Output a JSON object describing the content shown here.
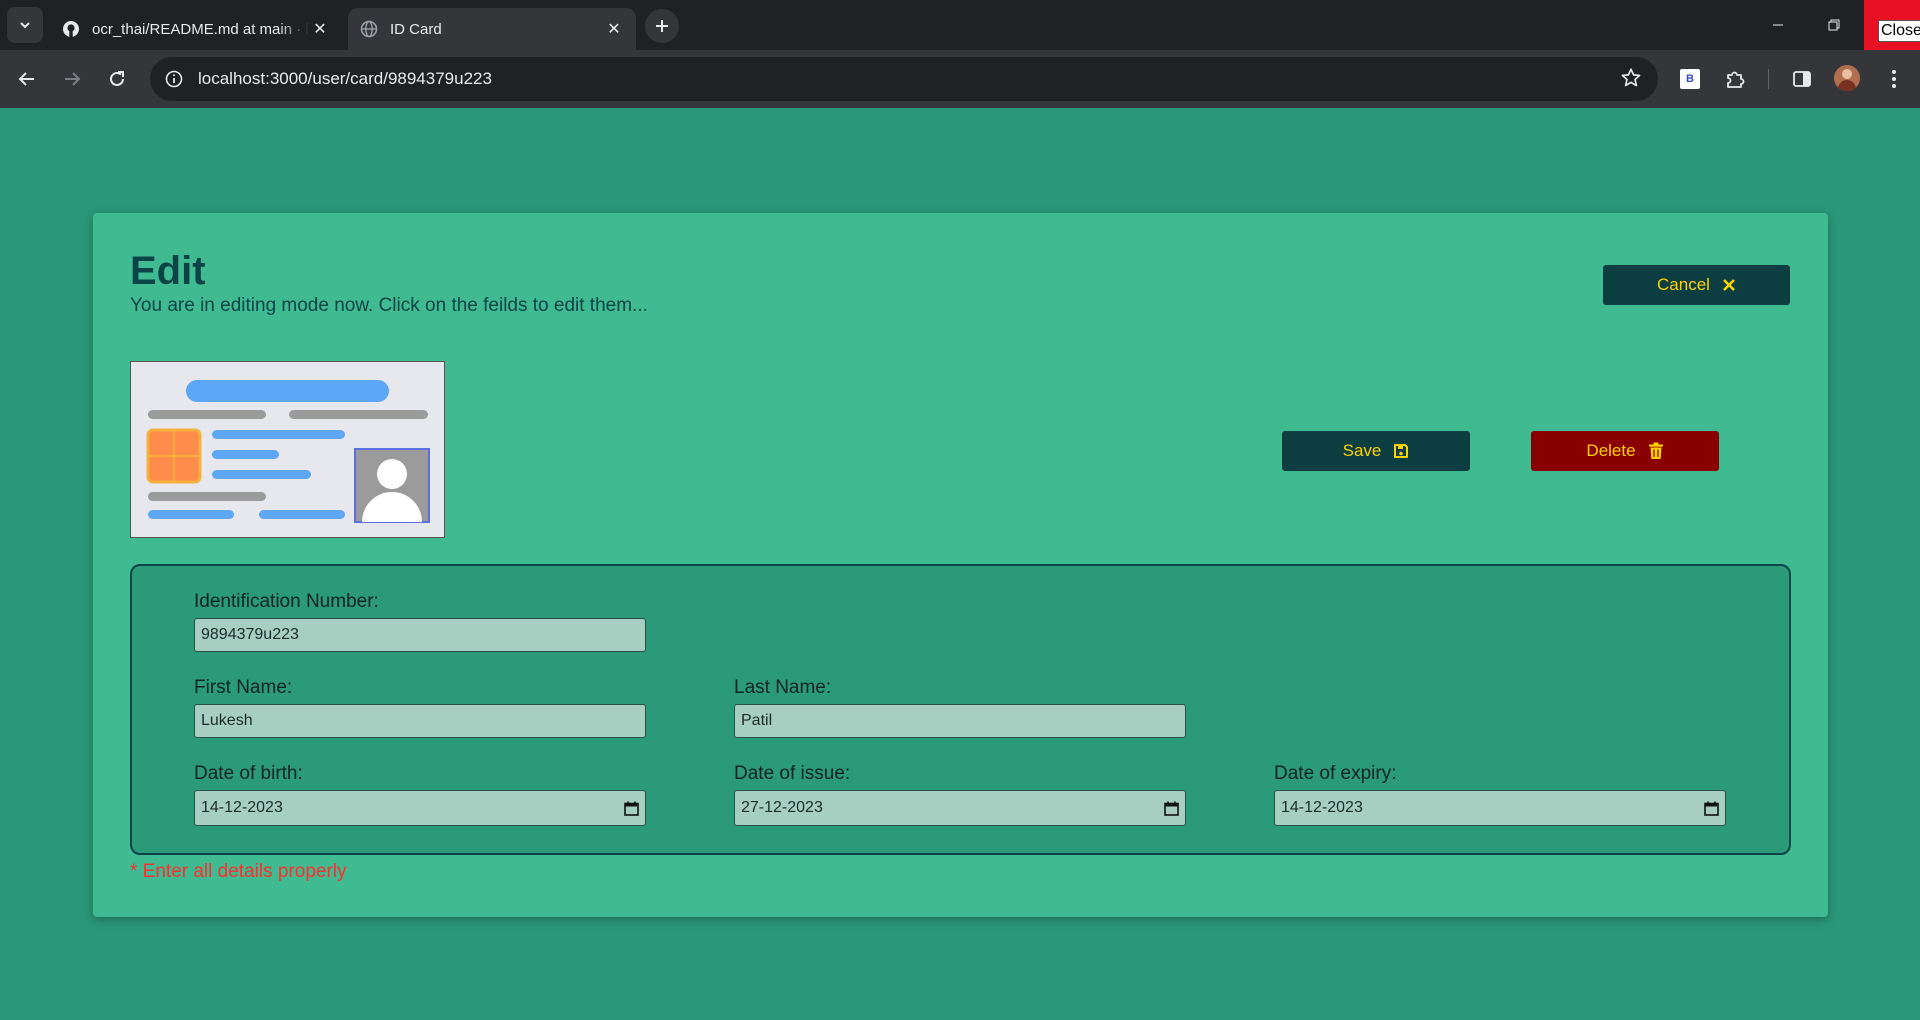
{
  "browser": {
    "tabs": [
      {
        "title": "ocr_thai/README.md at main · l",
        "active": false,
        "icon": "github-icon"
      },
      {
        "title": "ID Card",
        "active": true,
        "icon": "globe-icon"
      }
    ],
    "url": "localhost:3000/user/card/9894379u223",
    "extension_label": "B",
    "close_tooltip": "Close"
  },
  "page": {
    "title": "Edit",
    "subtitle": "You are in editing mode now. Click on the feilds to edit them...",
    "buttons": {
      "cancel": "Cancel",
      "save": "Save",
      "delete": "Delete"
    },
    "form": {
      "id_number": {
        "label": "Identification Number:",
        "value": "9894379u223"
      },
      "first_name": {
        "label": "First Name:",
        "value": "Lukesh"
      },
      "last_name": {
        "label": "Last Name:",
        "value": "Patil"
      },
      "dob": {
        "label": "Date of birth:",
        "value": "14-12-2023"
      },
      "issue": {
        "label": "Date of issue:",
        "value": "27-12-2023"
      },
      "expiry": {
        "label": "Date of expiry:",
        "value": "14-12-2023"
      }
    },
    "error": "* Enter all details properly"
  },
  "colors": {
    "page_bg": "#2a9878",
    "card_bg": "#40bb91",
    "heading": "#0b4446",
    "button_dark": "#0b3d41",
    "button_delete": "#8a0000",
    "button_text": "#ffd200",
    "error": "#ff2d2d"
  }
}
